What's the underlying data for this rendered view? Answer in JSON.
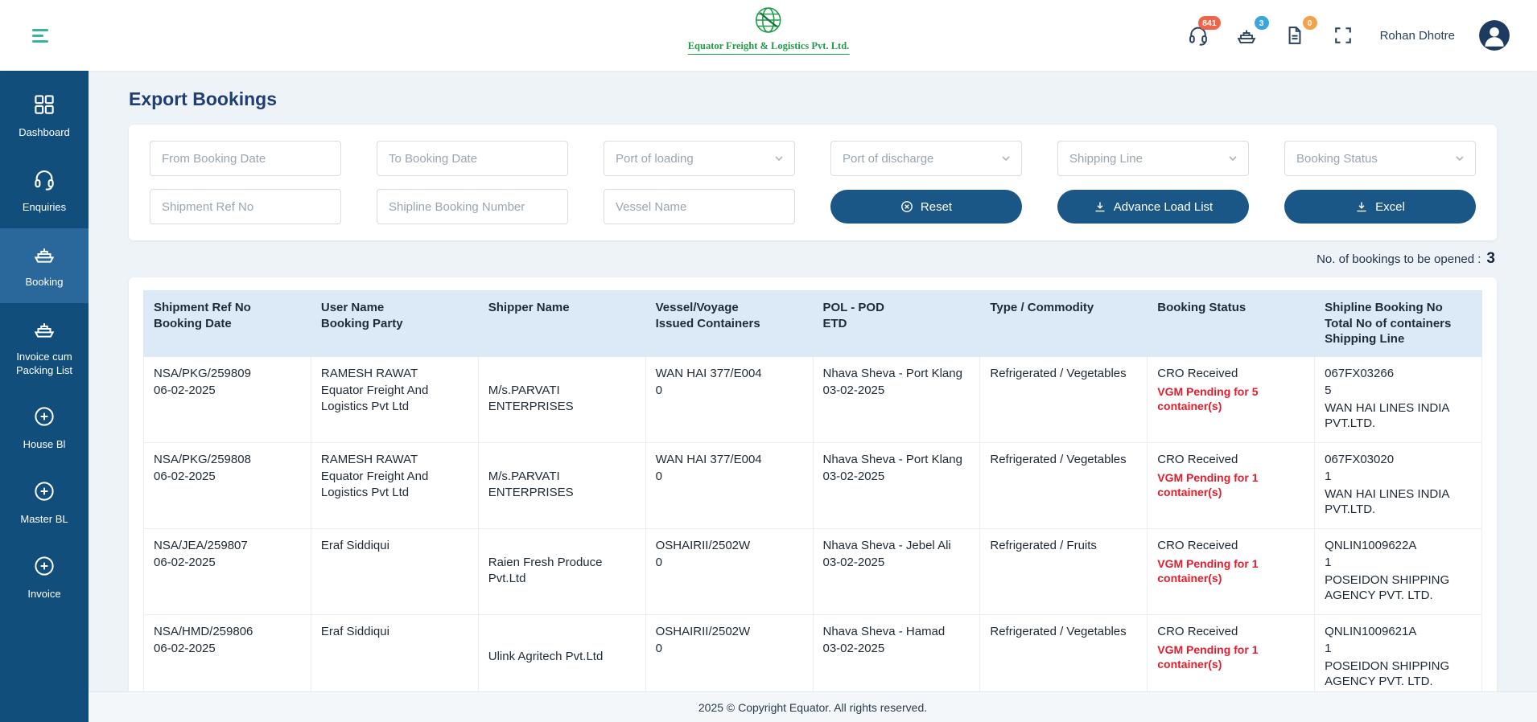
{
  "colors": {
    "sidebar": "#114e7c",
    "sidebar_active": "#2a689c",
    "primary_button": "#1a5787",
    "brand_green": "#1f9d4b",
    "alert_red": "#e11d2d",
    "table_header_bg": "#dce9f6",
    "badge_red": "#f06548",
    "badge_blue": "#3aa5de",
    "badge_orange": "#f5a14b"
  },
  "header": {
    "brand": "Equator Freight & Logistics Pvt. Ltd.",
    "user": "Rohan Dhotre",
    "badges": {
      "support": "841",
      "vessel": "3",
      "documents": "0"
    }
  },
  "sidebar": {
    "items": [
      {
        "label": "Dashboard",
        "icon": "dashboard-icon",
        "active": false
      },
      {
        "label": "Enquiries",
        "icon": "headset-icon",
        "active": false
      },
      {
        "label": "Booking",
        "icon": "ship-icon",
        "active": true
      },
      {
        "label": "Invoice cum Packing List",
        "icon": "ship-icon",
        "active": false
      },
      {
        "label": "House Bl",
        "icon": "plus-circle-icon",
        "active": false
      },
      {
        "label": "Master BL",
        "icon": "plus-circle-icon",
        "active": false
      },
      {
        "label": "Invoice",
        "icon": "plus-circle-icon",
        "active": false
      }
    ]
  },
  "page": {
    "title": "Export Bookings",
    "bookings_note": "No. of bookings to be opened :",
    "bookings_count": "3"
  },
  "filters": {
    "from_booking_date": "From Booking Date",
    "to_booking_date": "To Booking Date",
    "port_of_loading": "Port of loading",
    "port_of_discharge": "Port of discharge",
    "shipping_line": "Shipping Line",
    "booking_status": "Booking Status",
    "shipment_ref_no": "Shipment Ref No",
    "shipline_booking_number": "Shipline Booking Number",
    "vessel_name": "Vessel Name",
    "reset_label": "Reset",
    "advance_load_list_label": "Advance Load List",
    "excel_label": "Excel"
  },
  "table": {
    "columns": [
      {
        "lines": [
          "Shipment Ref No",
          "Booking Date"
        ]
      },
      {
        "lines": [
          "User Name",
          "Booking Party"
        ]
      },
      {
        "lines": [
          "Shipper Name"
        ]
      },
      {
        "lines": [
          "Vessel/Voyage",
          "Issued Containers"
        ]
      },
      {
        "lines": [
          "POL - POD",
          "ETD"
        ]
      },
      {
        "lines": [
          "Type / Commodity"
        ]
      },
      {
        "lines": [
          "Booking Status"
        ]
      },
      {
        "lines": [
          "Shipline Booking No",
          "Total No of containers",
          "Shipping Line"
        ]
      }
    ],
    "rows": [
      {
        "cells": [
          [
            "NSA/PKG/259809",
            "06-02-2025"
          ],
          [
            "RAMESH RAWAT",
            "Equator Freight And Logistics Pvt Ltd"
          ],
          [
            "M/s.PARVATI ENTERPRISES"
          ],
          [
            "WAN HAI 377/E004",
            "0"
          ],
          [
            "Nhava Sheva - Port Klang",
            "03-02-2025"
          ],
          [
            "Refrigerated / Vegetables"
          ],
          [
            "CRO Received",
            {
              "text": "VGM Pending for 5 container(s)",
              "alert": true
            }
          ],
          [
            "067FX03266",
            "5",
            "WAN HAI LINES INDIA PVT.LTD."
          ]
        ]
      },
      {
        "cells": [
          [
            "NSA/PKG/259808",
            "06-02-2025"
          ],
          [
            "RAMESH RAWAT",
            "Equator Freight And Logistics Pvt Ltd"
          ],
          [
            "M/s.PARVATI ENTERPRISES"
          ],
          [
            "WAN HAI 377/E004",
            "0"
          ],
          [
            "Nhava Sheva - Port Klang",
            "03-02-2025"
          ],
          [
            "Refrigerated / Vegetables"
          ],
          [
            "CRO Received",
            {
              "text": "VGM Pending for 1 container(s)",
              "alert": true
            }
          ],
          [
            "067FX03020",
            "1",
            "WAN HAI LINES INDIA PVT.LTD."
          ]
        ]
      },
      {
        "cells": [
          [
            "NSA/JEA/259807",
            "06-02-2025"
          ],
          [
            "Eraf Siddiqui"
          ],
          [
            "Raien Fresh Produce Pvt.Ltd"
          ],
          [
            "OSHAIRII/2502W",
            "0"
          ],
          [
            "Nhava Sheva - Jebel Ali",
            "03-02-2025"
          ],
          [
            "Refrigerated / Fruits"
          ],
          [
            "CRO Received",
            {
              "text": "VGM Pending for 1 container(s)",
              "alert": true
            }
          ],
          [
            "QNLIN1009622A",
            "1",
            "POSEIDON SHIPPING AGENCY PVT. LTD."
          ]
        ]
      },
      {
        "cells": [
          [
            "NSA/HMD/259806",
            "06-02-2025"
          ],
          [
            "Eraf Siddiqui"
          ],
          [
            "Ulink Agritech Pvt.Ltd"
          ],
          [
            "OSHAIRII/2502W",
            "0"
          ],
          [
            "Nhava Sheva - Hamad",
            "03-02-2025"
          ],
          [
            "Refrigerated / Vegetables"
          ],
          [
            "CRO Received",
            {
              "text": "VGM Pending for 1 container(s)",
              "alert": true
            }
          ],
          [
            "QNLIN1009621A",
            "1",
            "POSEIDON SHIPPING AGENCY PVT. LTD."
          ]
        ]
      }
    ]
  },
  "footer": {
    "copyright": "2025 © Copyright Equator. All rights reserved."
  }
}
